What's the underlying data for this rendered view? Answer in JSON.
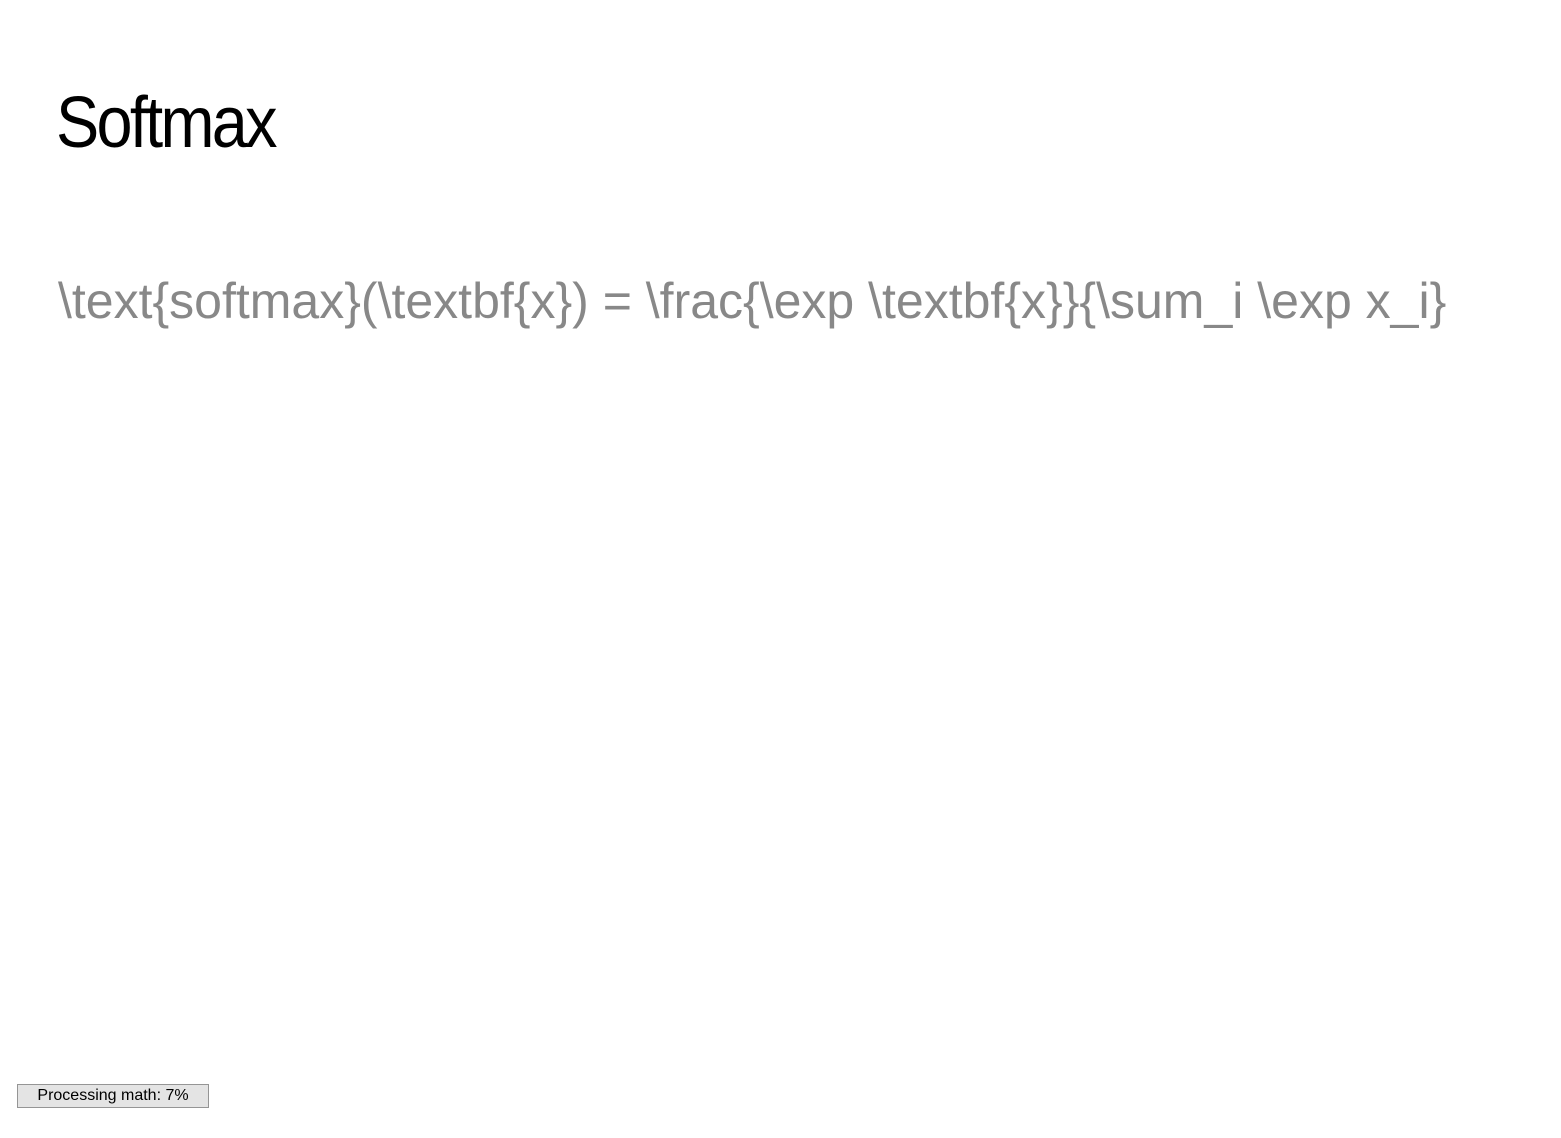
{
  "slide": {
    "title": "Softmax",
    "math_source": "\\text{softmax}(\\textbf{x}) = \\frac{\\exp \\textbf{x}}{\\sum_i \\exp x_i}"
  },
  "status": {
    "processing_text": "Processing math: 7%",
    "progress_percent": 7
  },
  "colors": {
    "title": "#000000",
    "math_text": "#888888",
    "badge_background": "#e4e4e4",
    "badge_border": "#959595"
  }
}
